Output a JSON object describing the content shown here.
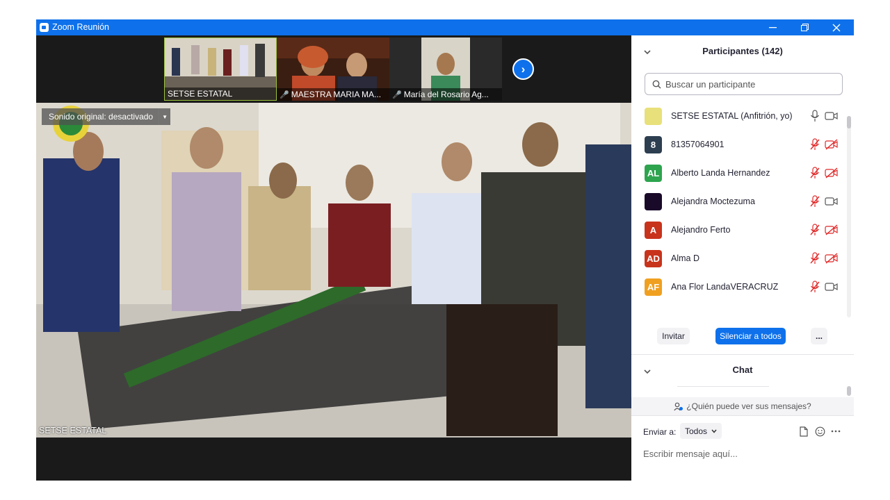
{
  "window": {
    "title": "Zoom Reunión",
    "accent_color": "#0e71eb"
  },
  "thumbnails": [
    {
      "name": "SETSE ESTATAL",
      "muted": false,
      "icon": "group-photo"
    },
    {
      "name": "MAESTRA MARIA MA...",
      "muted": true,
      "icon": "two-people"
    },
    {
      "name": "María del Rosario Ag...",
      "muted": true,
      "icon": "single-person"
    }
  ],
  "main_video": {
    "sound_label": "Sonido original: desactivado",
    "speaker_name": "SETSE ESTATAL"
  },
  "participants": {
    "title": "Participantes (142)",
    "search_placeholder": "Buscar un participante",
    "list": [
      {
        "name": "SETSE ESTATAL (Anfitrión, yo)",
        "avatar_text": "",
        "avatar_color": "#e8e07a",
        "mic_muted": false,
        "video_off": false
      },
      {
        "name": "81357064901",
        "avatar_text": "8",
        "avatar_color": "#2d3e50",
        "mic_muted": true,
        "video_off": true
      },
      {
        "name": "Alberto Landa Hernandez",
        "avatar_text": "AL",
        "avatar_color": "#2ea44f",
        "mic_muted": true,
        "video_off": true
      },
      {
        "name": "Alejandra Moctezuma",
        "avatar_text": "",
        "avatar_color": "#1a0a2a",
        "mic_muted": true,
        "video_off": false
      },
      {
        "name": "Alejandro Ferto",
        "avatar_text": "A",
        "avatar_color": "#c8331c",
        "mic_muted": true,
        "video_off": true
      },
      {
        "name": "Alma D",
        "avatar_text": "AD",
        "avatar_color": "#c8331c",
        "mic_muted": true,
        "video_off": true
      },
      {
        "name": "Ana Flor LandaVERACRUZ",
        "avatar_text": "AF",
        "avatar_color": "#f0a020",
        "mic_muted": true,
        "video_off": false
      }
    ],
    "invite_label": "Invitar",
    "mute_all_label": "Silenciar a todos",
    "more_label": "..."
  },
  "chat": {
    "title": "Chat",
    "who_can_see": "¿Quién puede ver sus mensajes?",
    "send_to_label": "Enviar a:",
    "recipient": "Todos",
    "input_placeholder": "Escribir mensaje aquí..."
  }
}
